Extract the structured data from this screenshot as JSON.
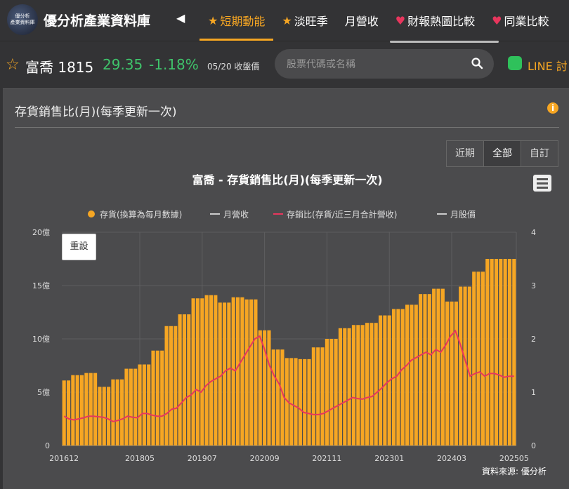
{
  "header": {
    "logo_line1": "優分析",
    "logo_line2": "產業資料庫",
    "site_title": "優分析產業資料庫",
    "nav_items": [
      {
        "icon": "star-icon",
        "label": "短期動能",
        "active": true
      },
      {
        "icon": "star-icon",
        "label": "淡旺季",
        "active": false
      },
      {
        "icon": "",
        "label": "月營收",
        "active": false
      },
      {
        "icon": "heart-icon",
        "label": "財報熱圖比較",
        "active": false
      },
      {
        "icon": "heart-icon",
        "label": "同業比較",
        "active": false
      }
    ]
  },
  "stock": {
    "name": "富喬 1815",
    "price": "29.35",
    "change": "-1.18%",
    "date": "05/20 收盤價"
  },
  "search": {
    "placeholder": "股票代碼或名稱"
  },
  "line_label": "LINE 討",
  "card": {
    "title": "存貨銷售比(月)(每季更新一次)",
    "range_buttons": [
      "近期",
      "全部",
      "自訂"
    ],
    "selected_range": "全部",
    "reset_label": "重設",
    "source": "資料來源: 優分析"
  },
  "colors": {
    "bar": "#f6a623",
    "ratio_line": "#e8365d",
    "green": "#3fc46b",
    "accent": "#f6a623"
  },
  "chart_data": {
    "type": "bar",
    "title": "富喬 - 存貨銷售比(月)(每季更新一次)",
    "legend": [
      {
        "name": "存貨(換算為每月數據)",
        "marker": "dot",
        "color": "#f6a623"
      },
      {
        "name": "月營收",
        "marker": "line",
        "color": "#cccccc"
      },
      {
        "name": "存銷比(存貨/近三月合計營收)",
        "marker": "line",
        "color": "#e8365d"
      },
      {
        "name": "月股價",
        "marker": "line",
        "color": "#cccccc"
      }
    ],
    "legend_position": "top",
    "grid": true,
    "left_axis": {
      "ticks": [
        "0",
        "5億",
        "10億",
        "15億",
        "20億"
      ],
      "range": [
        0,
        20
      ],
      "unit": "億"
    },
    "right_axis": {
      "ticks": [
        "0",
        "1",
        "2",
        "3",
        "4"
      ],
      "range": [
        0,
        4
      ]
    },
    "x_tick_labels": [
      "201612",
      "201805",
      "201907",
      "202009",
      "202111",
      "202301",
      "202403",
      "202505"
    ],
    "x_start": "201612",
    "quarter_inventory": [
      6.1,
      6.6,
      6.8,
      5.5,
      6.2,
      7.2,
      7.6,
      8.9,
      11.2,
      12.3,
      13.8,
      14.1,
      13.4,
      13.9,
      13.7,
      10.8,
      9.0,
      8.2,
      8.1,
      9.2,
      10.0,
      11.0,
      11.3,
      11.5,
      12.2,
      12.8,
      13.2,
      14.2,
      14.7,
      13.5,
      14.9,
      16.3,
      17.5
    ],
    "ratio_monthly": [
      0.55,
      0.5,
      0.48,
      0.5,
      0.52,
      0.55,
      0.55,
      0.54,
      0.53,
      0.5,
      0.45,
      0.47,
      0.5,
      0.55,
      0.53,
      0.52,
      0.6,
      0.6,
      0.57,
      0.55,
      0.55,
      0.6,
      0.68,
      0.7,
      0.8,
      0.9,
      0.95,
      1.05,
      1.0,
      1.12,
      1.2,
      1.25,
      1.3,
      1.4,
      1.45,
      1.4,
      1.55,
      1.7,
      1.85,
      2.0,
      2.05,
      1.8,
      1.5,
      1.3,
      1.15,
      0.9,
      0.8,
      0.75,
      0.7,
      0.62,
      0.6,
      0.58,
      0.58,
      0.6,
      0.65,
      0.7,
      0.75,
      0.8,
      0.85,
      0.9,
      0.88,
      0.87,
      0.9,
      0.92,
      1.0,
      1.08,
      1.18,
      1.25,
      1.3,
      1.42,
      1.5,
      1.6,
      1.65,
      1.7,
      1.75,
      1.7,
      1.8,
      1.75,
      1.88,
      2.05,
      2.15,
      1.9,
      1.6,
      1.3,
      1.35,
      1.38,
      1.3,
      1.35,
      1.35,
      1.32,
      1.28,
      1.3,
      1.3
    ]
  }
}
